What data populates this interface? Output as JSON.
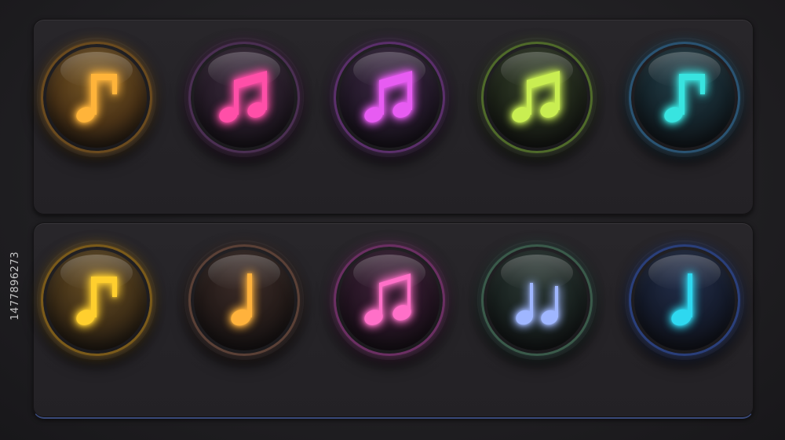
{
  "watermark": {
    "text": "1477896273"
  },
  "rows": [
    {
      "name": "top",
      "buttons": [
        {
          "icon": "eighth-note-flag-icon",
          "note": "#ffb43a",
          "glow": "rgba(255,170,40,0.55)",
          "rim": "#6a4a1e",
          "face": "#4a3216",
          "face_hi": "#7a5a26"
        },
        {
          "icon": "beamed-eighth-notes-icon",
          "note": "#ff4fa8",
          "glow": "rgba(200,60,200,0.35)",
          "rim": "#4a2f52",
          "face": "#241a26",
          "face_hi": "#3a2a3c"
        },
        {
          "icon": "beamed-eighth-notes-icon",
          "note": "#e75cf2",
          "glow": "rgba(190,70,230,0.4)",
          "rim": "#5a2f6a",
          "face": "#221828",
          "face_hi": "#3b2843"
        },
        {
          "icon": "beamed-eighth-notes-icon",
          "note": "#c9ee52",
          "glow": "rgba(160,220,80,0.35)",
          "rim": "#4f6a2a",
          "face": "#1d2318",
          "face_hi": "#34402a"
        },
        {
          "icon": "eighth-note-flag-icon",
          "note": "#38e4e0",
          "glow": "rgba(40,160,220,0.45)",
          "rim": "#2a5372",
          "face": "#142229",
          "face_hi": "#23414b"
        }
      ]
    },
    {
      "name": "bottom",
      "buttons": [
        {
          "icon": "eighth-note-flag-icon",
          "note": "#ffcf2e",
          "glow": "rgba(255,180,30,0.6)",
          "rim": "#7a5a1a",
          "face": "#3c2c16",
          "face_hi": "#6a5024"
        },
        {
          "icon": "quarter-note-icon",
          "note": "#ffb23c",
          "glow": "rgba(200,120,80,0.3)",
          "rim": "#5a4036",
          "face": "#231a18",
          "face_hi": "#3c2c28"
        },
        {
          "icon": "beamed-eighth-notes-outline-icon",
          "note": "#ff70c8",
          "glow": "rgba(230,80,200,0.5)",
          "rim": "#6a2f62",
          "face": "#241422",
          "face_hi": "#3e2239"
        },
        {
          "icon": "double-quarter-notes-icon",
          "note": "#9fb6ff",
          "glow": "rgba(90,200,160,0.35)",
          "rim": "#3a5a4a",
          "face": "#18201e",
          "face_hi": "#2b3834"
        },
        {
          "icon": "quarter-note-icon",
          "note": "#2ed8f0",
          "glow": "rgba(50,100,230,0.5)",
          "rim": "#2a3f7a",
          "face": "#141a2a",
          "face_hi": "#222e4a"
        }
      ]
    }
  ]
}
